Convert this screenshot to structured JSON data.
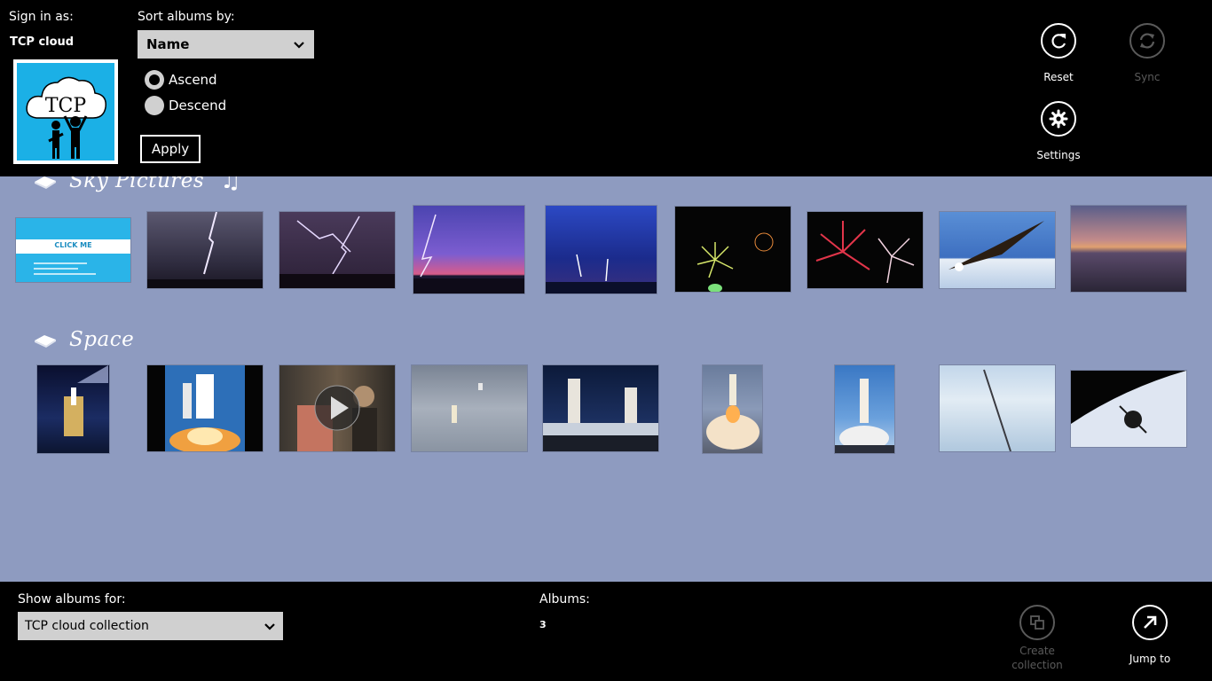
{
  "header": {
    "sign_in_label": "Sign in as:",
    "account_name": "TCP cloud",
    "avatar_text": "TCP",
    "sort_label": "Sort albums by:",
    "sort_value": "Name",
    "ascend_label": "Ascend",
    "descend_label": "Descend",
    "sort_order_selected": "Ascend",
    "apply_label": "Apply",
    "reset_label": "Reset",
    "sync_label": "Sync",
    "settings_label": "Settings"
  },
  "albums": [
    {
      "title": "Sky Pictures",
      "has_music_icon": true
    },
    {
      "title": "Space"
    }
  ],
  "sky_thumbs": [
    {
      "name": "click-me-slide",
      "text": "CLICK ME"
    },
    {
      "name": "lightning-bolt"
    },
    {
      "name": "lightning-storm"
    },
    {
      "name": "purple-lightning"
    },
    {
      "name": "blue-lightning"
    },
    {
      "name": "fireworks-green"
    },
    {
      "name": "fireworks-red"
    },
    {
      "name": "eagle-flying"
    },
    {
      "name": "sunset-lake"
    }
  ],
  "space_thumbs": [
    {
      "name": "shuttle-night"
    },
    {
      "name": "shuttle-launch"
    },
    {
      "name": "astronaut-video"
    },
    {
      "name": "shuttle-fog"
    },
    {
      "name": "shuttles-pad"
    },
    {
      "name": "rocket-liftoff"
    },
    {
      "name": "rocket-tower"
    },
    {
      "name": "contrail-clouds"
    },
    {
      "name": "orbit-earth"
    }
  ],
  "footer": {
    "show_label": "Show albums for:",
    "collection_value": "TCP cloud collection",
    "albums_label": "Albums:",
    "albums_count": "3",
    "create_label_line1": "Create",
    "create_label_line2": "collection",
    "jump_label": "Jump to"
  },
  "colors": {
    "content_background": "#8e9bc0",
    "bar_background": "#000000",
    "avatar_background": "#1bb0e6",
    "disabled": "#5a5a5a"
  }
}
